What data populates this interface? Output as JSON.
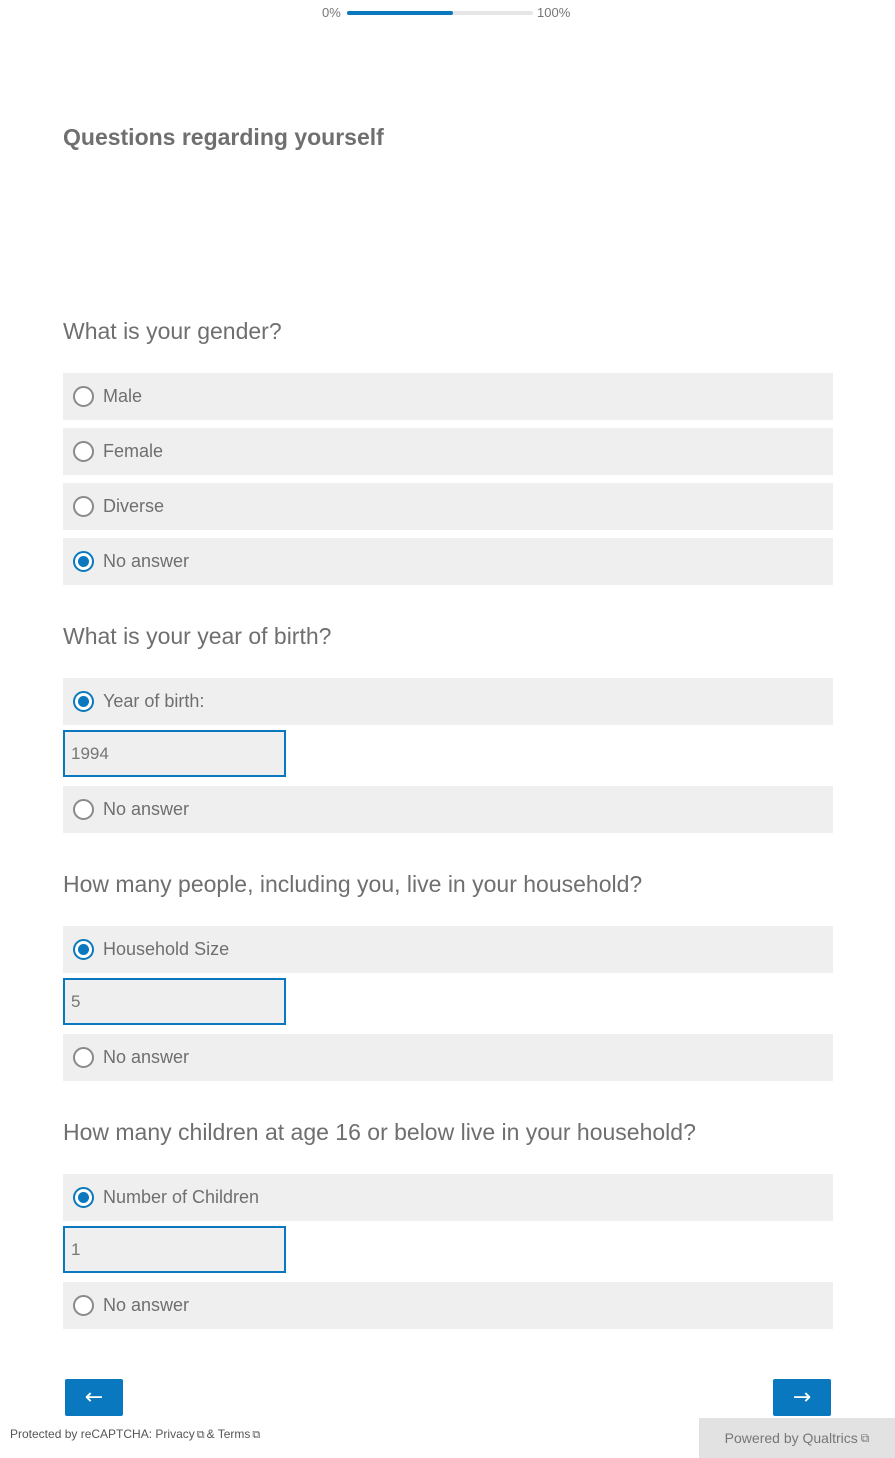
{
  "progress": {
    "start_label": "0%",
    "end_label": "100%",
    "value": 0.57
  },
  "section_title": "Questions regarding yourself",
  "q_gender": {
    "text": "What is your gender?",
    "options": [
      "Male",
      "Female",
      "Diverse",
      "No answer"
    ],
    "selected": "No answer"
  },
  "q_birth": {
    "text": "What is your year of birth?",
    "option_label": "Year of birth:",
    "value": "1994",
    "no_answer": "No answer"
  },
  "q_household": {
    "text": "How many people, including you, live in your household?",
    "option_label": "Household Size",
    "value": "5",
    "no_answer": "No answer"
  },
  "q_children": {
    "text": "How many children at age 16 or below live in your household?",
    "option_label": "Number of Children",
    "value": "1",
    "no_answer": "No answer"
  },
  "nav": {
    "back_label": "←",
    "next_label": "→"
  },
  "footer": {
    "recaptcha_prefix": "Protected by reCAPTCHA:",
    "privacy": "Privacy",
    "and": "&",
    "terms": "Terms",
    "powered": "Powered by Qualtrics",
    "external_icon": "⧉"
  },
  "colors": {
    "accent": "#0a78be",
    "option_bg": "#efefef",
    "text": "#6f6f6f"
  }
}
